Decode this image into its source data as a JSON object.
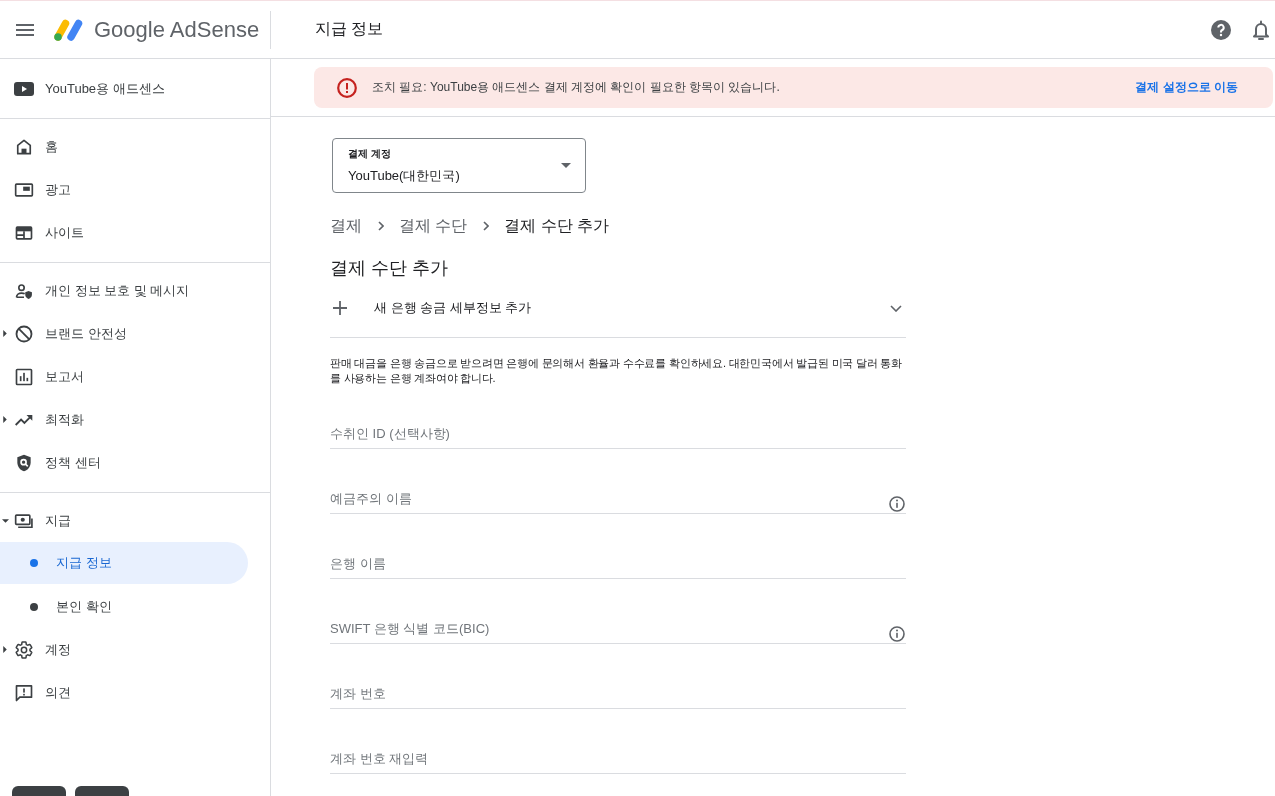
{
  "top_bar": {
    "product_name": "Google AdSense",
    "page_title": "지급 정보"
  },
  "sidebar": {
    "header": "YouTube용 애드센스",
    "groups": [
      {
        "items": [
          {
            "label": "홈",
            "selected": false
          },
          {
            "label": "광고",
            "selected": false
          },
          {
            "label": "사이트",
            "selected": false
          }
        ]
      },
      {
        "items": [
          {
            "label": "개인 정보 보호 및 메시지",
            "selected": false
          },
          {
            "label": "브랜드 안전성",
            "selected": false,
            "expanded": false
          },
          {
            "label": "보고서",
            "selected": false
          },
          {
            "label": "최적화",
            "selected": false,
            "expanded": false
          },
          {
            "label": "정책 센터",
            "selected": false
          }
        ]
      },
      {
        "items": [
          {
            "label": "지급",
            "selected": false,
            "expanded": true,
            "children": [
              {
                "label": "지급 정보",
                "selected": true
              },
              {
                "label": "본인 확인",
                "selected": false
              }
            ]
          },
          {
            "label": "계정",
            "selected": false,
            "expanded": false
          },
          {
            "label": "의견",
            "selected": false
          }
        ]
      }
    ]
  },
  "alert": {
    "message": "조치 필요: YouTube용 애드센스 결제 계정에 확인이 필요한 항목이 있습니다.",
    "action": "결제 설정으로 이동"
  },
  "billing_account_select": {
    "label": "결제 계정",
    "value": "YouTube(대한민국)"
  },
  "breadcrumb": [
    {
      "label": "결제",
      "current": false
    },
    {
      "label": "결제 수단",
      "current": false
    },
    {
      "label": "결제 수단 추가",
      "current": true
    }
  ],
  "heading": "결제 수단 추가",
  "add_option": {
    "label": "새 은행 송금 세부정보 추가"
  },
  "notice": "판매 대금을 은행 송금으로 받으려면 은행에 문의해서 환율과 수수료를 확인하세요. 대한민국에서 발급된 미국 달러 통화를 사용하는 은행 계좌여야 합니다.",
  "fields": [
    {
      "placeholder": "수취인 ID (선택사항)",
      "info": false
    },
    {
      "placeholder": "예금주의 이름",
      "info": true
    },
    {
      "placeholder": "은행 이름",
      "info": false
    },
    {
      "placeholder": "SWIFT 은행 식별 코드(BIC)",
      "info": true
    },
    {
      "placeholder": "계좌 번호",
      "info": false
    },
    {
      "placeholder": "계좌 번호 재입력",
      "info": false
    }
  ]
}
